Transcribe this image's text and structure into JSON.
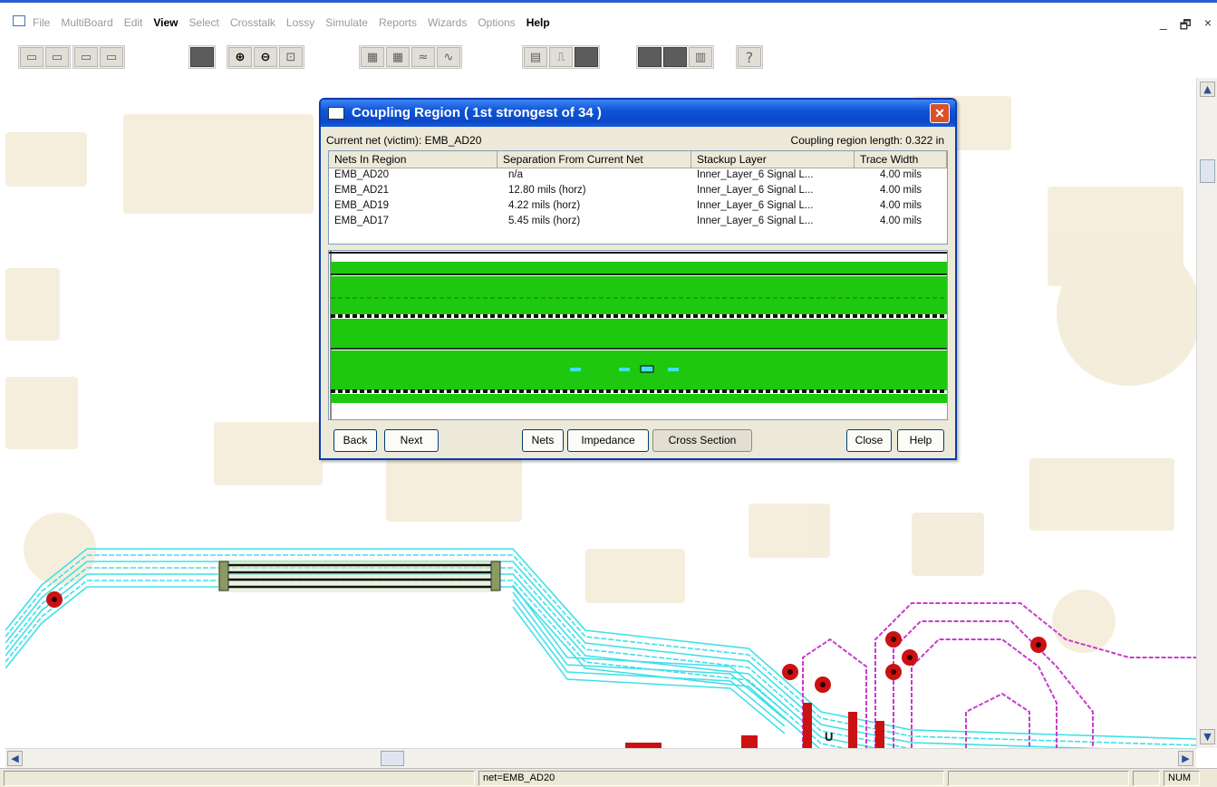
{
  "menu": {
    "items": [
      {
        "label": "File",
        "active": false
      },
      {
        "label": "MultiBoard",
        "active": false
      },
      {
        "label": "Edit",
        "active": false
      },
      {
        "label": "View",
        "active": true
      },
      {
        "label": "Select",
        "active": false
      },
      {
        "label": "Crosstalk",
        "active": false
      },
      {
        "label": "Lossy",
        "active": false
      },
      {
        "label": "Simulate",
        "active": false
      },
      {
        "label": "Reports",
        "active": false
      },
      {
        "label": "Wizards",
        "active": false
      },
      {
        "label": "Options",
        "active": false
      },
      {
        "label": "Help",
        "active": true
      }
    ],
    "window_controls": {
      "minimize": "_",
      "restore": "🗗",
      "close": "×"
    }
  },
  "toolbar": {
    "help_glyph": "?",
    "icons": {
      "zoom_in": "⊕",
      "zoom_out": "⊖"
    }
  },
  "dialog": {
    "title": "Coupling Region  ( 1st strongest of 34 )",
    "close_glyph": "✕",
    "current_net": "Current net (victim): EMB_AD20",
    "region_length": "Coupling region length: 0.322 in",
    "columns": [
      "Nets In Region",
      "Separation From Current Net",
      "Stackup Layer",
      "Trace Width"
    ],
    "rows": [
      [
        "EMB_AD20",
        "n/a",
        "Inner_Layer_6 Signal L...",
        "4.00 mils"
      ],
      [
        "EMB_AD21",
        "12.80 mils (horz)",
        "Inner_Layer_6 Signal L...",
        "4.00 mils"
      ],
      [
        "EMB_AD19",
        "4.22 mils (horz)",
        "Inner_Layer_6 Signal L...",
        "4.00 mils"
      ],
      [
        "EMB_AD17",
        "5.45 mils (horz)",
        "Inner_Layer_6 Signal L...",
        "4.00 mils"
      ]
    ],
    "buttons": {
      "back": "Back",
      "next": "Next",
      "nets": "Nets",
      "impedance": "Impedance",
      "cross_section": "Cross Section",
      "close": "Close",
      "help": "Help"
    }
  },
  "canvas": {
    "component_label": "U",
    "colors": {
      "trace_primary": "#3fe0e8",
      "trace_secondary": "#c83ccc",
      "via": "#cc1111",
      "plane": "#f5ecd8",
      "dielectric": "#1ec80f"
    }
  },
  "statusbar": {
    "net": "net=EMB_AD20",
    "num": "NUM"
  }
}
